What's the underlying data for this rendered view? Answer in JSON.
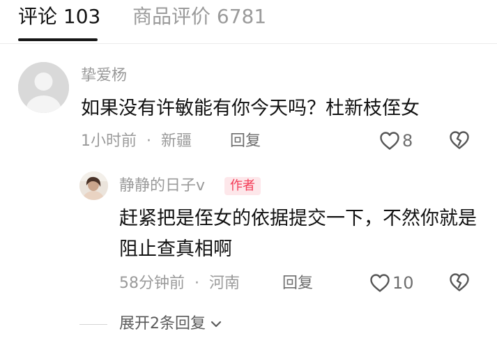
{
  "tabs": [
    {
      "label": "评论 103",
      "active": true
    },
    {
      "label": "商品评价 6781",
      "active": false
    }
  ],
  "comment": {
    "username": "挚爱杨",
    "text": "如果没有许敏能有你今天吗？杜新枝侄女",
    "time": "1小时前",
    "separator": "·",
    "location": "新疆",
    "reply_label": "回复",
    "like_count": "8",
    "avatar_icon": "default-avatar-icon"
  },
  "reply": {
    "username": "静静的日子v",
    "author_badge": "作者",
    "text": "赶紧把是侄女的依据提交一下，不然你就是阻止查真相啊",
    "time": "58分钟前",
    "separator": "·",
    "location": "河南",
    "reply_label": "回复",
    "like_count": "10"
  },
  "expand": {
    "label": "展开2条回复",
    "icon": "chevron-down-icon"
  },
  "colors": {
    "primary_text": "#111111",
    "secondary_text": "#9a9a9a",
    "badge_bg": "#fde7ea",
    "badge_text": "#f33b56"
  }
}
